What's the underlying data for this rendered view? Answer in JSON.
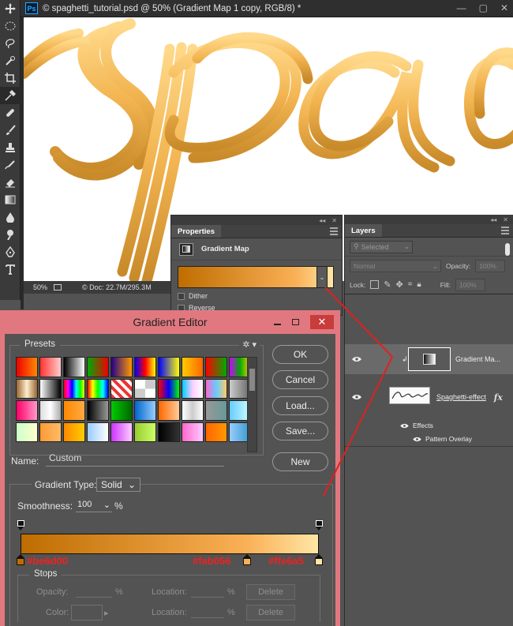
{
  "document": {
    "ps_badge": "Ps",
    "title": "© spaghetti_tutorial.psd @ 50% (Gradient Map 1 copy, RGB/8) *",
    "zoom": "50%",
    "doc_info": "© Doc: 22.7M/295.3M"
  },
  "properties": {
    "tab": "Properties",
    "title": "Gradient Map",
    "dither_label": "Dither",
    "reverse_label": "Reverse"
  },
  "layers": {
    "tab": "Layers",
    "filter_value": "Selected",
    "blend_mode": "Normal",
    "opacity_label": "Opacity:",
    "opacity_value": "100%",
    "lock_label": "Lock:",
    "fill_label": "Fill:",
    "fill_value": "100%",
    "items": [
      {
        "name": "Gradient Ma..."
      },
      {
        "name": "Spaghetti-effect"
      }
    ],
    "effects_label": "Effects",
    "pattern_overlay_label": "Pattern Overlay",
    "fx_label": "fx"
  },
  "gradient_editor": {
    "title": "Gradient Editor",
    "presets_label": "Presets",
    "buttons": {
      "ok": "OK",
      "cancel": "Cancel",
      "load": "Load...",
      "save": "Save...",
      "new": "New"
    },
    "name_label": "Name:",
    "name_value": "Custom",
    "gradient_type_label": "Gradient Type:",
    "gradient_type_value": "Solid",
    "smoothness_label": "Smoothness:",
    "smoothness_value": "100",
    "percent": "%",
    "stops": {
      "label": "Stops",
      "opacity_label": "Opacity:",
      "color_label": "Color:",
      "location_label": "Location:",
      "delete_label": "Delete"
    },
    "color_stops": [
      {
        "hex": "#be6d00",
        "position": 0.0
      },
      {
        "hex": "#fab056",
        "position": 0.76
      },
      {
        "hex": "#ffe6a5",
        "position": 1.0
      }
    ],
    "color_stop_labels": [
      "#be6d00",
      "#fab056",
      "#ffe6a5"
    ],
    "opacity_stops": [
      {
        "position": 0.0
      },
      {
        "position": 1.0
      }
    ],
    "presets": [
      "linear-gradient(90deg,#e00,#f80)",
      "linear-gradient(90deg,#f33,#fcc)",
      "linear-gradient(90deg,#000,#fff)",
      "linear-gradient(90deg,#0a0,#e00)",
      "linear-gradient(90deg,#208,#f90)",
      "linear-gradient(90deg,#00f,#f00,#ff0)",
      "linear-gradient(90deg,#00f,#ff0)",
      "linear-gradient(90deg,#fc0,#f60)",
      "linear-gradient(90deg,#f00,#0a0)",
      "linear-gradient(90deg,#c0f,#0a0,#fc0)",
      "linear-gradient(90deg,#963,#fec,#963)",
      "linear-gradient(90deg,#fff,#000)",
      "linear-gradient(90deg,#f00,#f0f,#00f,#0ff,#0f0,#ff0)",
      "linear-gradient(90deg,#f00,#ff0,#0f0,#0ff,#00f)",
      "repeating-linear-gradient(45deg,#e33 0 4px,#fff 4px 8px)",
      "repeating-conic-gradient(#ccc 0 25%,#fff 0 50%)",
      "linear-gradient(90deg,#f00,#00f,#0f0)",
      "linear-gradient(90deg,#0cf,#fcf,#fff)",
      "linear-gradient(90deg,#f6c,#6cf,#fc6)",
      "linear-gradient(90deg,#ccc,#999,#666)",
      "linear-gradient(90deg,#f06,#f9c)",
      "linear-gradient(90deg,#ddd,#fff,#aaa)",
      "linear-gradient(90deg,#f80,#fa4)",
      "linear-gradient(90deg,#000,#999)",
      "linear-gradient(90deg,#0c0,#060)",
      "linear-gradient(90deg,#06c,#9cf)",
      "linear-gradient(90deg,#f60,#fc9)",
      "linear-gradient(90deg,#fff,#ccc,#fff)",
      "linear-gradient(90deg,#999,#699)",
      "linear-gradient(90deg,#6cf,#cff)",
      "linear-gradient(90deg,#cfc,#ffc)",
      "linear-gradient(90deg,#f93,#fb6)",
      "linear-gradient(90deg,#f80,#fc0)",
      "linear-gradient(90deg,#9cf,#fff)",
      "linear-gradient(90deg,#c3f,#fcf)",
      "linear-gradient(90deg,#9c3,#cf6)",
      "linear-gradient(90deg,#000,#333)",
      "linear-gradient(90deg,#f6c,#fcf)",
      "linear-gradient(90deg,#f60,#f90)",
      "linear-gradient(90deg,#9cf,#39c)"
    ]
  },
  "colors": {
    "accent_red": "#e02020",
    "dialog_title_bg": "#e1787f",
    "panel_bg": "#535353"
  }
}
